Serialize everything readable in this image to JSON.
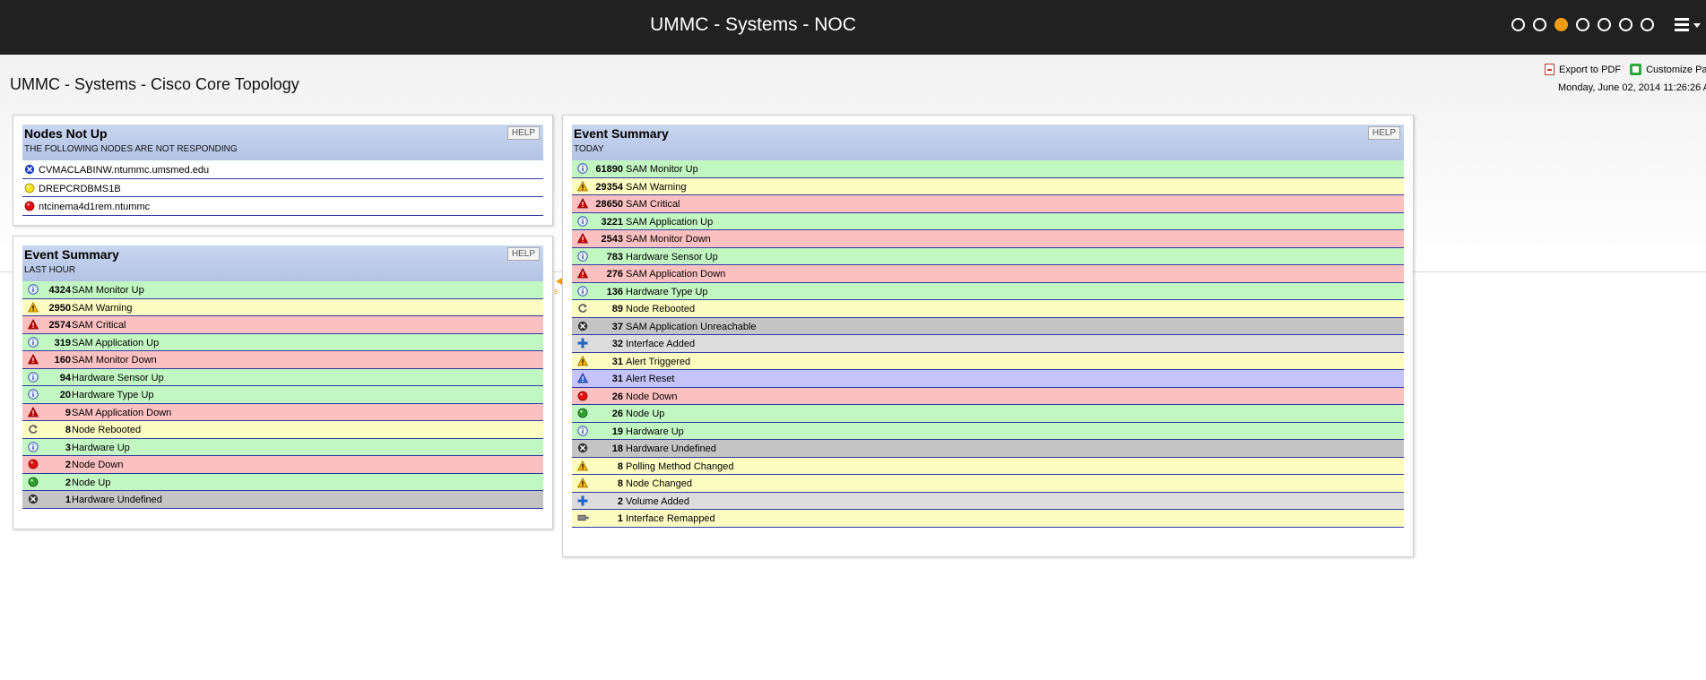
{
  "header": {
    "title": "UMMC - Systems - NOC",
    "page_dots": [
      {
        "active": false
      },
      {
        "active": false
      },
      {
        "active": true
      },
      {
        "active": false
      },
      {
        "active": false
      },
      {
        "active": false
      },
      {
        "active": false
      }
    ]
  },
  "page": {
    "title": "UMMC - Systems - Cisco Core Topology",
    "export_pdf": "Export to PDF",
    "customize": "Customize Pag",
    "datetime": "Monday, June 02, 2014 11:26:26 A",
    "collapse_text": "s"
  },
  "nodes_panel": {
    "title": "Nodes Not Up",
    "subtitle": "THE FOLLOWING NODES ARE NOT RESPONDING",
    "help": "HELP",
    "nodes": [
      {
        "name": "CVMACLABINW.ntummc.umsmed.edu",
        "icon": "unreachable-icon"
      },
      {
        "name": "DREPCRDBMS1B",
        "icon": "warning-dot-icon"
      },
      {
        "name": "ntcinema4d1rem.ntummc",
        "icon": "down-dot-icon"
      }
    ]
  },
  "hour_panel": {
    "title": "Event Summary",
    "subtitle": "LAST HOUR",
    "help": "HELP",
    "rows": [
      {
        "count": "4324",
        "label": "SAM Monitor Up",
        "status": "green",
        "icon": "info-icon"
      },
      {
        "count": "2950",
        "label": "SAM Warning",
        "status": "yellow",
        "icon": "warning-icon"
      },
      {
        "count": "2574",
        "label": "SAM Critical",
        "status": "red",
        "icon": "critical-icon"
      },
      {
        "count": "319",
        "label": "SAM Application Up",
        "status": "green",
        "icon": "info-icon"
      },
      {
        "count": "160",
        "label": "SAM Monitor Down",
        "status": "red",
        "icon": "critical-icon"
      },
      {
        "count": "94",
        "label": "Hardware Sensor Up",
        "status": "green",
        "icon": "info-icon"
      },
      {
        "count": "20",
        "label": "Hardware Type Up",
        "status": "green",
        "icon": "info-icon"
      },
      {
        "count": "9",
        "label": "SAM Application Down",
        "status": "red",
        "icon": "critical-icon"
      },
      {
        "count": "8",
        "label": "Node Rebooted",
        "status": "yellow",
        "icon": "reboot-icon"
      },
      {
        "count": "3",
        "label": "Hardware Up",
        "status": "green",
        "icon": "info-icon"
      },
      {
        "count": "2",
        "label": "Node Down",
        "status": "red",
        "icon": "down-dot-icon"
      },
      {
        "count": "2",
        "label": "Node Up",
        "status": "green",
        "icon": "up-dot-icon"
      },
      {
        "count": "1",
        "label": "Hardware Undefined",
        "status": "gray",
        "icon": "undefined-icon"
      }
    ]
  },
  "today_panel": {
    "title": "Event Summary",
    "subtitle": "TODAY",
    "help": "HELP",
    "rows": [
      {
        "count": "61890",
        "label": "SAM Monitor Up",
        "status": "green",
        "icon": "info-icon"
      },
      {
        "count": "29354",
        "label": "SAM Warning",
        "status": "yellow",
        "icon": "warning-icon"
      },
      {
        "count": "28650",
        "label": "SAM Critical",
        "status": "red",
        "icon": "critical-icon"
      },
      {
        "count": "3221",
        "label": "SAM Application Up",
        "status": "green",
        "icon": "info-icon"
      },
      {
        "count": "2543",
        "label": "SAM Monitor Down",
        "status": "red",
        "icon": "critical-icon"
      },
      {
        "count": "783",
        "label": "Hardware Sensor Up",
        "status": "green",
        "icon": "info-icon"
      },
      {
        "count": "276",
        "label": "SAM Application Down",
        "status": "red",
        "icon": "critical-icon"
      },
      {
        "count": "136",
        "label": "Hardware Type Up",
        "status": "green",
        "icon": "info-icon"
      },
      {
        "count": "89",
        "label": "Node Rebooted",
        "status": "yellow",
        "icon": "reboot-icon"
      },
      {
        "count": "37",
        "label": "SAM Application Unreachable",
        "status": "gray",
        "icon": "undefined-icon"
      },
      {
        "count": "32",
        "label": "Interface Added",
        "status": "lgray",
        "icon": "add-icon"
      },
      {
        "count": "31",
        "label": "Alert Triggered",
        "status": "yellow",
        "icon": "warning-icon"
      },
      {
        "count": "31",
        "label": "Alert Reset",
        "status": "blue",
        "icon": "alert-reset-icon"
      },
      {
        "count": "26",
        "label": "Node Down",
        "status": "red",
        "icon": "down-dot-icon"
      },
      {
        "count": "26",
        "label": "Node Up",
        "status": "green",
        "icon": "up-dot-icon"
      },
      {
        "count": "19",
        "label": "Hardware Up",
        "status": "green",
        "icon": "info-icon"
      },
      {
        "count": "18",
        "label": "Hardware Undefined",
        "status": "gray",
        "icon": "undefined-icon"
      },
      {
        "count": "8",
        "label": "Polling Method Changed",
        "status": "yellow",
        "icon": "warning-icon"
      },
      {
        "count": "8",
        "label": "Node Changed",
        "status": "yellow",
        "icon": "warning-icon"
      },
      {
        "count": "2",
        "label": "Volume Added",
        "status": "lgray",
        "icon": "add-icon"
      },
      {
        "count": "1",
        "label": "Interface Remapped",
        "status": "yellow",
        "icon": "remap-icon"
      }
    ]
  },
  "colors": {
    "topbar": "#212121",
    "active_dot": "#f39c12",
    "green": "#c2f7c2",
    "yellow": "#fdfcc0",
    "red": "#fcc0c0",
    "gray": "#c4c4c4",
    "blue": "#c4c4fb"
  }
}
